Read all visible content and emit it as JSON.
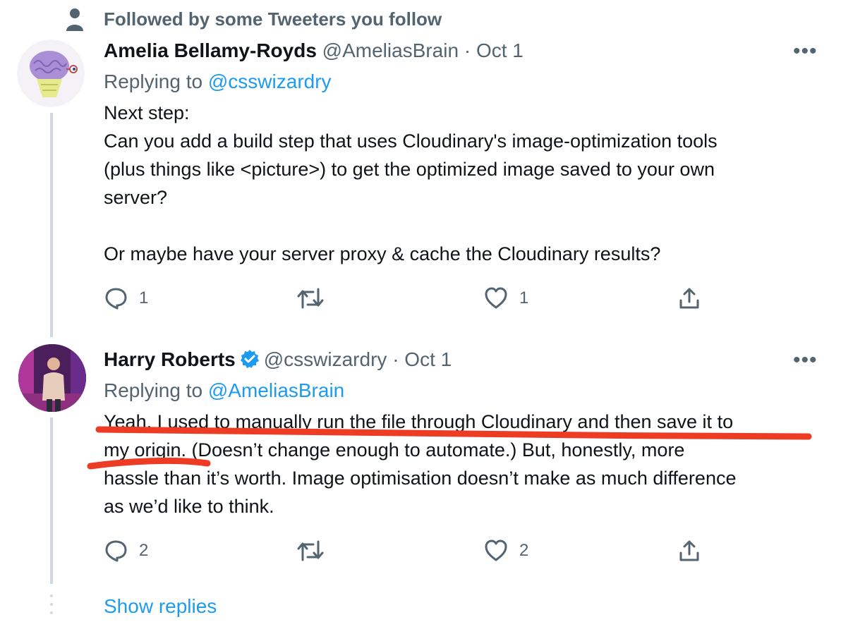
{
  "social_context": "Followed by some Tweeters you follow",
  "tweets": [
    {
      "name": "Amelia Bellamy-Royds",
      "handle": "@AmeliasBrain",
      "sep": "·",
      "date": "Oct 1",
      "replying_prefix": "Replying to",
      "replying_to": "@csswizardry",
      "body": "Next step:\nCan you add a build step that uses Cloudinary's image-optimization tools\n(plus things like <picture>) to get the optimized image saved to your own\nserver?\n\nOr maybe have your server proxy & cache the Cloudinary results?",
      "reply_count": "1",
      "like_count": "1",
      "more_label": "•••"
    },
    {
      "name": "Harry Roberts",
      "handle": "@csswizardry",
      "sep": "·",
      "date": "Oct 1",
      "replying_prefix": "Replying to",
      "replying_to": "@AmeliasBrain",
      "body": "Yeah, I used to manually run the file through Cloudinary and then save it to\nmy origin. (Doesn’t change enough to automate.) But, honestly, more\nhassle than it’s worth. Image optimisation doesn’t make as much difference\nas we’d like to think.",
      "reply_count": "2",
      "like_count": "2",
      "more_label": "•••"
    }
  ],
  "show_replies": "Show replies",
  "colors": {
    "annotation": "#ee3b24",
    "link": "#1d9bf0",
    "verified": "#1d9bf0",
    "muted": "#536471"
  },
  "icons": [
    "person-icon",
    "reply-icon",
    "retweet-icon",
    "like-icon",
    "share-icon",
    "verified-badge-icon",
    "more-icon"
  ]
}
